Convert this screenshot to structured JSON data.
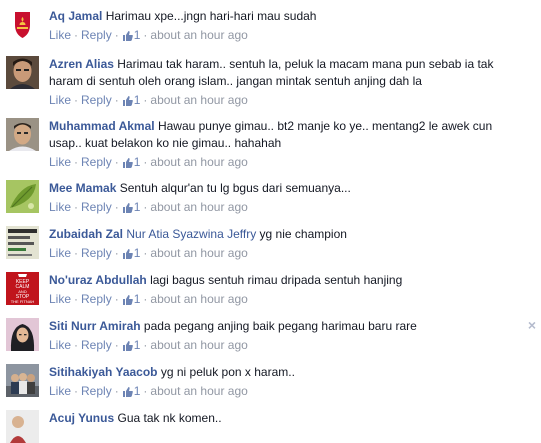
{
  "actions": {
    "like": "Like",
    "reply": "Reply",
    "separator": "·"
  },
  "comments": [
    {
      "name": "Aq Jamal",
      "mention": "",
      "text": "Harimau xpe...jngn hari-hari mau sudah",
      "likes": "1",
      "time": "about an hour ago"
    },
    {
      "name": "Azren Alias",
      "mention": "",
      "text": "Harimau tak haram.. sentuh la, peluk la macam mana pun sebab ia tak haram di sentuh oleh orang islam.. jangan mintak sentuh anjing dah la",
      "likes": "1",
      "time": "about an hour ago"
    },
    {
      "name": "Muhammad Akmal",
      "mention": "",
      "text": "Hawau punye gimau.. bt2 manje ko ye.. mentang2 le awek cun usap.. kuat belakon ko nie gimau.. hahahah",
      "likes": "1",
      "time": "about an hour ago"
    },
    {
      "name": "Mee Mamak",
      "mention": "",
      "text": "Sentuh alqur'an tu lg bgus dari semuanya...",
      "likes": "1",
      "time": "about an hour ago"
    },
    {
      "name": "Zubaidah Zal",
      "mention": "Nur Atia Syazwina Jeffry",
      "text": "yg nie champion",
      "likes": "1",
      "time": "about an hour ago"
    },
    {
      "name": "No'uraz Abdullah",
      "mention": "",
      "text": "lagi bagus sentuh rimau dripada sentuh hanjing",
      "likes": "1",
      "time": "about an hour ago"
    },
    {
      "name": "Siti Nurr Amirah",
      "mention": "",
      "text": "pada pegang anjing baik pegang harimau baru rare",
      "likes": "1",
      "time": "about an hour ago"
    },
    {
      "name": "Sitihakiyah Yaacob",
      "mention": "",
      "text": "yg ni peluk pon x haram..",
      "likes": "1",
      "time": "about an hour ago"
    },
    {
      "name": "Acuj Yunus",
      "mention": "",
      "text": "Gua tak nk komen..",
      "likes": "",
      "time": ""
    }
  ],
  "avatars": [
    {
      "icon": "liverpool-crest-icon",
      "bg": "#c8102e"
    },
    {
      "icon": "man-face-icon",
      "bg": "#6b5a4a"
    },
    {
      "icon": "man-face-icon",
      "bg": "#8a8070"
    },
    {
      "icon": "leaf-photo-icon",
      "bg": "#8bb04a"
    },
    {
      "icon": "poster-icon",
      "bg": "#d9d9c4"
    },
    {
      "icon": "keep-calm-poster-icon",
      "bg": "#c0141c",
      "poster_lines": [
        "KEEP",
        "CALM",
        "AND",
        "STOP",
        "THE FITNAH"
      ]
    },
    {
      "icon": "hijab-woman-icon",
      "bg": "#d7b1c8"
    },
    {
      "icon": "group-photo-icon",
      "bg": "#7a7f8a"
    },
    {
      "icon": "person-photo-icon",
      "bg": "#e6e6e6"
    }
  ],
  "close_glyph": "×"
}
